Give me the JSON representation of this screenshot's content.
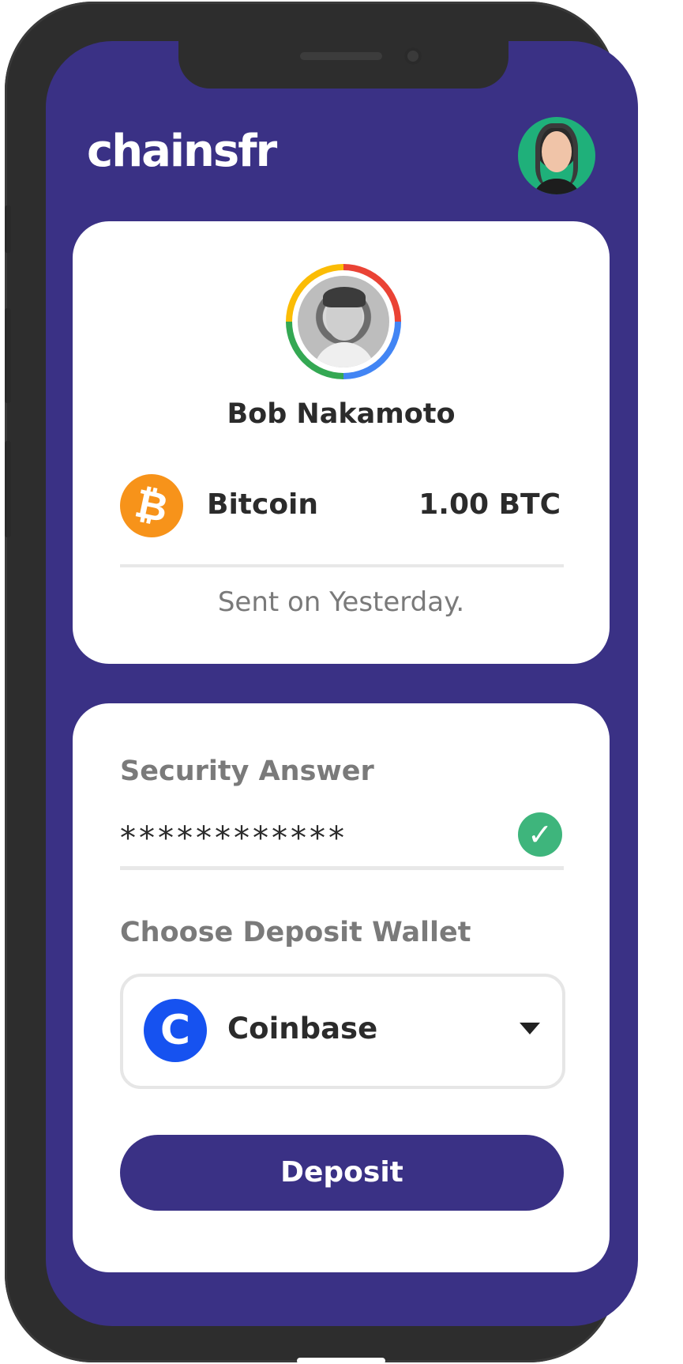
{
  "app": {
    "logo_text": "chainsfr"
  },
  "transfer": {
    "sender_name": "Bob Nakamoto",
    "coin_name": "Bitcoin",
    "coin_symbol_glyph": "₿",
    "amount": "1.00 BTC",
    "sent_text": "Sent on Yesterday."
  },
  "security": {
    "label": "Security Answer",
    "value": "************",
    "valid_glyph": "✓"
  },
  "wallet": {
    "label": "Choose Deposit Wallet",
    "selected": "Coinbase",
    "icon_glyph": "C"
  },
  "actions": {
    "deposit_label": "Deposit"
  },
  "colors": {
    "brand": "#3a3185",
    "bitcoin": "#f7931a",
    "coinbase": "#1652f0",
    "success": "#3eb57c"
  }
}
